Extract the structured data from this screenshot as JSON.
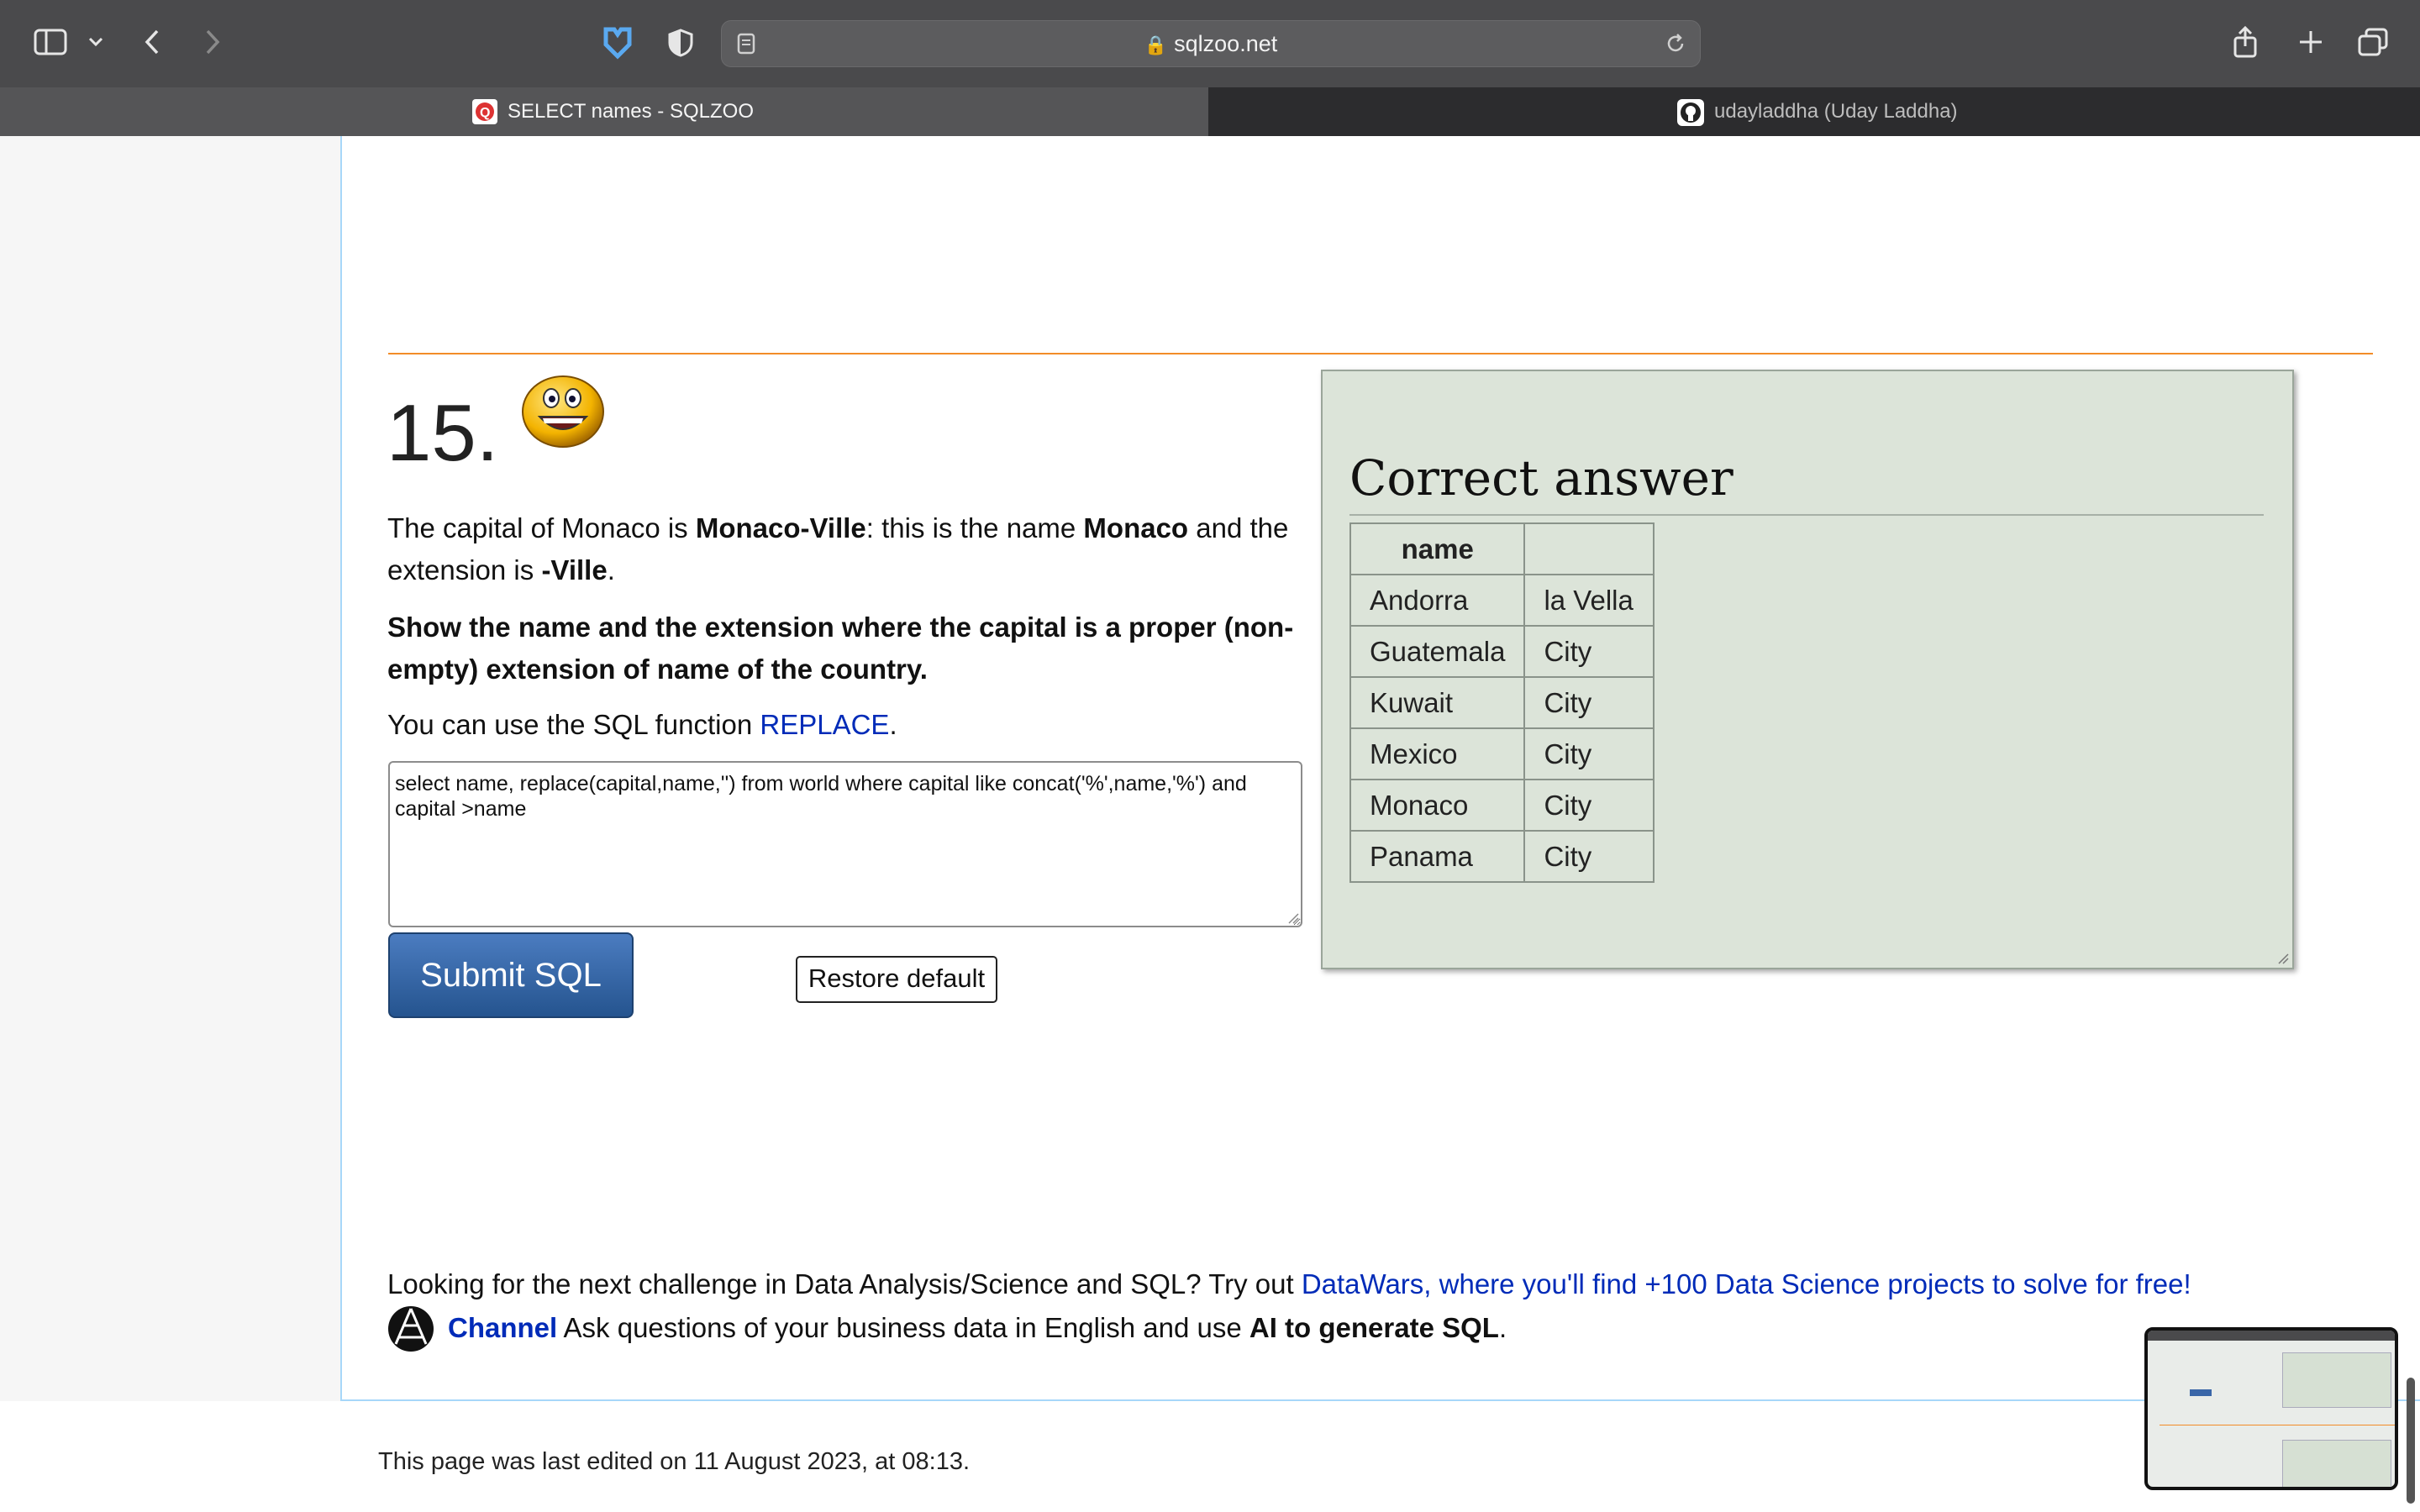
{
  "browser": {
    "url": "sqlzoo.net",
    "tabs": [
      {
        "label": "SELECT names - SQLZOO",
        "active": true
      },
      {
        "label": "udayladdha (Uday Laddha)",
        "active": false
      }
    ],
    "icons": {
      "sidebar": "sidebar-icon",
      "back": "chevron-left-icon",
      "forward": "chevron-right-icon",
      "share": "share-icon",
      "new_tab": "plus-icon",
      "tabs_overview": "tabs-overview-icon"
    }
  },
  "question": {
    "number": "15.",
    "intro_a": "The capital of Monaco is ",
    "intro_b": "Monaco-Ville",
    "intro_c": ": this is the name ",
    "intro_d": "Monaco",
    "intro_e": " and the extension is ",
    "intro_f": "-Ville",
    "intro_g": ".",
    "task": "Show the name and the extension where the capital is a proper (non-empty) extension of name of the country.",
    "hint_a": "You can use the SQL function ",
    "hint_link": "REPLACE",
    "hint_b": ".",
    "sql": "select name, replace(capital,name,'') from world where capital like concat('%',name,'%') and capital >name",
    "submit_label": "Submit SQL",
    "restore_label": "Restore default"
  },
  "answer": {
    "title": "Correct answer",
    "headers": [
      "name",
      ""
    ],
    "rows": [
      [
        "Andorra",
        "la Vella"
      ],
      [
        "Guatemala",
        "City"
      ],
      [
        "Kuwait",
        "City"
      ],
      [
        "Mexico",
        "City"
      ],
      [
        "Monaco",
        "City"
      ],
      [
        "Panama",
        "City"
      ]
    ]
  },
  "footer": {
    "promo_text": "Looking for the next challenge in Data Analysis/Science and SQL? Try out ",
    "promo_link": "DataWars, where you'll find +100 Data Science projects to solve for free!",
    "channel_name": "Channel",
    "channel_text_a": " Ask questions of your business data in English and use ",
    "channel_text_b": "AI to generate SQL",
    "channel_text_c": ".",
    "last_edited": "This page was last edited on 11 August 2023, at 08:13."
  },
  "colors": {
    "link": "#002bb8",
    "rule": "#f28c28",
    "answer_bg": "#dce4d9",
    "submit_bg": "#25548f"
  }
}
